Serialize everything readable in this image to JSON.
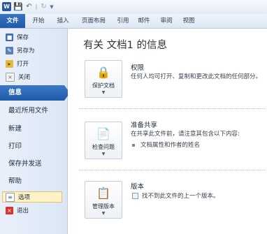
{
  "quick_access": {
    "app_icon": "W",
    "save_icon": "save-icon",
    "undo_icon": "undo-icon",
    "separator": "|",
    "redo_icon": "redo-icon",
    "menu_icon": "customize-icon"
  },
  "tabs": [
    "文件",
    "开始",
    "插入",
    "页面布局",
    "引用",
    "邮件",
    "审阅",
    "视图"
  ],
  "nav": {
    "commands_top": [
      {
        "label": "保存",
        "icon": "save-icon"
      },
      {
        "label": "另存为",
        "icon": "save-as-icon"
      },
      {
        "label": "打开",
        "icon": "open-folder-icon"
      },
      {
        "label": "关闭",
        "icon": "close-document-icon"
      }
    ],
    "sections": [
      "信息",
      "最近所用文件",
      "新建",
      "打印",
      "保存并发送",
      "帮助"
    ],
    "commands_bottom": [
      {
        "label": "选项",
        "icon": "options-icon"
      },
      {
        "label": "退出",
        "icon": "exit-icon"
      }
    ]
  },
  "main": {
    "title": "有关 文档1 的信息",
    "permissions": {
      "button_label": "保护文档",
      "title": "权限",
      "text": "任何人均可打开、复制和更改此文档的任何部分。"
    },
    "prepare": {
      "button_label": "检查问题",
      "title": "准备共享",
      "text": "在共享此文件前，请注意其包含以下内容:",
      "bullet": "文档属性和作者的姓名"
    },
    "versions": {
      "button_label": "管理版本",
      "title": "版本",
      "text": "找不到此文件的上一个版本。"
    }
  },
  "colors": {
    "accent": "#1f5aa8",
    "nav_bg": "#dbe6f5",
    "highlight": "#fdf2c8"
  }
}
